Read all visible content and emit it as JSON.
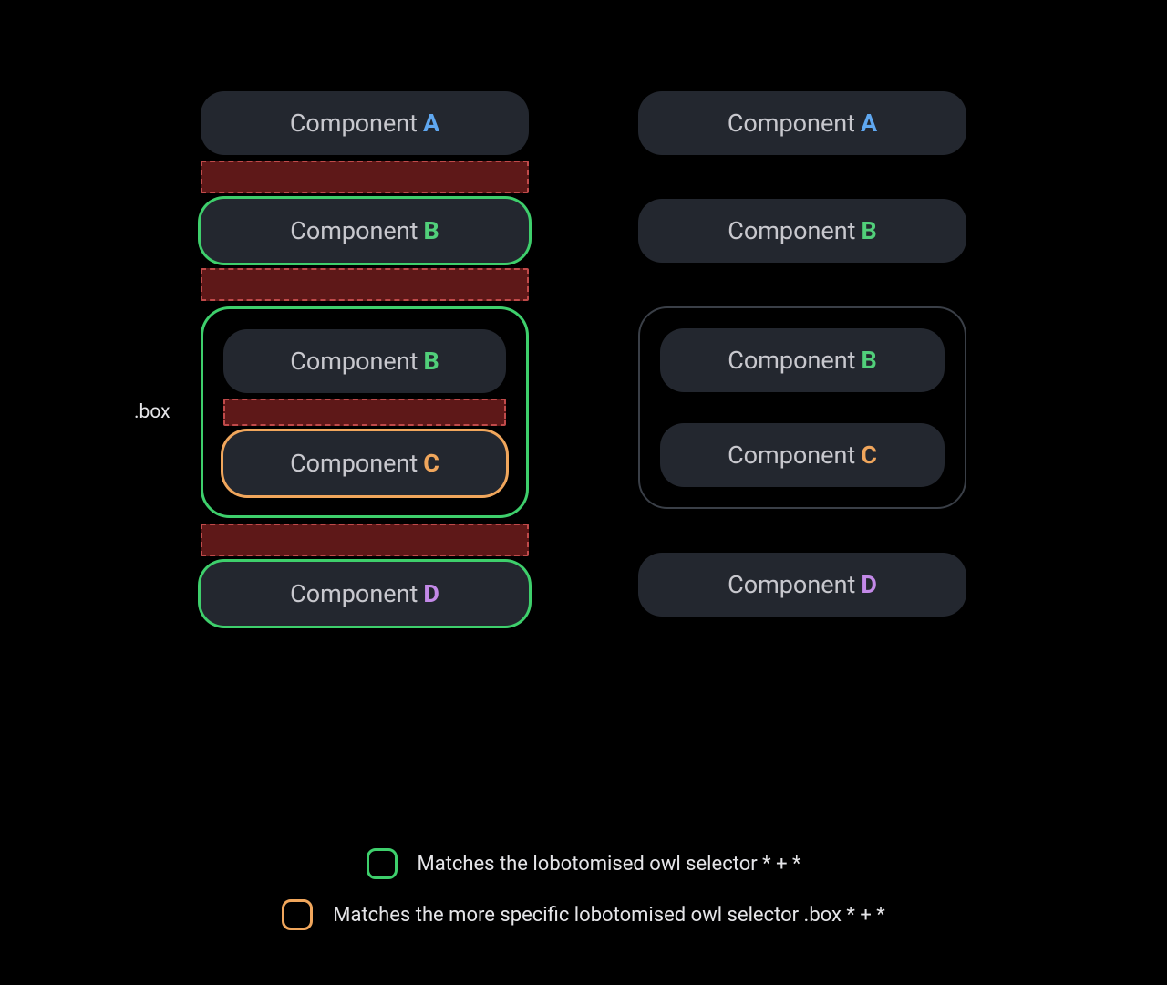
{
  "labels": {
    "component_prefix": "Component",
    "letters": {
      "a": "A",
      "b": "B",
      "c": "C",
      "d": "D"
    },
    "box_label": ".box"
  },
  "legend": {
    "green": "Matches the lobotomised owl selector * + *",
    "orange": "Matches the more specific lobotomised owl selector .box * + *"
  },
  "colors": {
    "bg": "#000000",
    "pill": "#23272f",
    "green": "#3ecf6c",
    "orange": "#f0a65c",
    "margin_fill": "#5e1818",
    "margin_border": "#c04a4a",
    "letter_a": "#5fa7f0",
    "letter_b": "#51cf7a",
    "letter_c": "#f0a65c",
    "letter_d": "#c389e8"
  }
}
